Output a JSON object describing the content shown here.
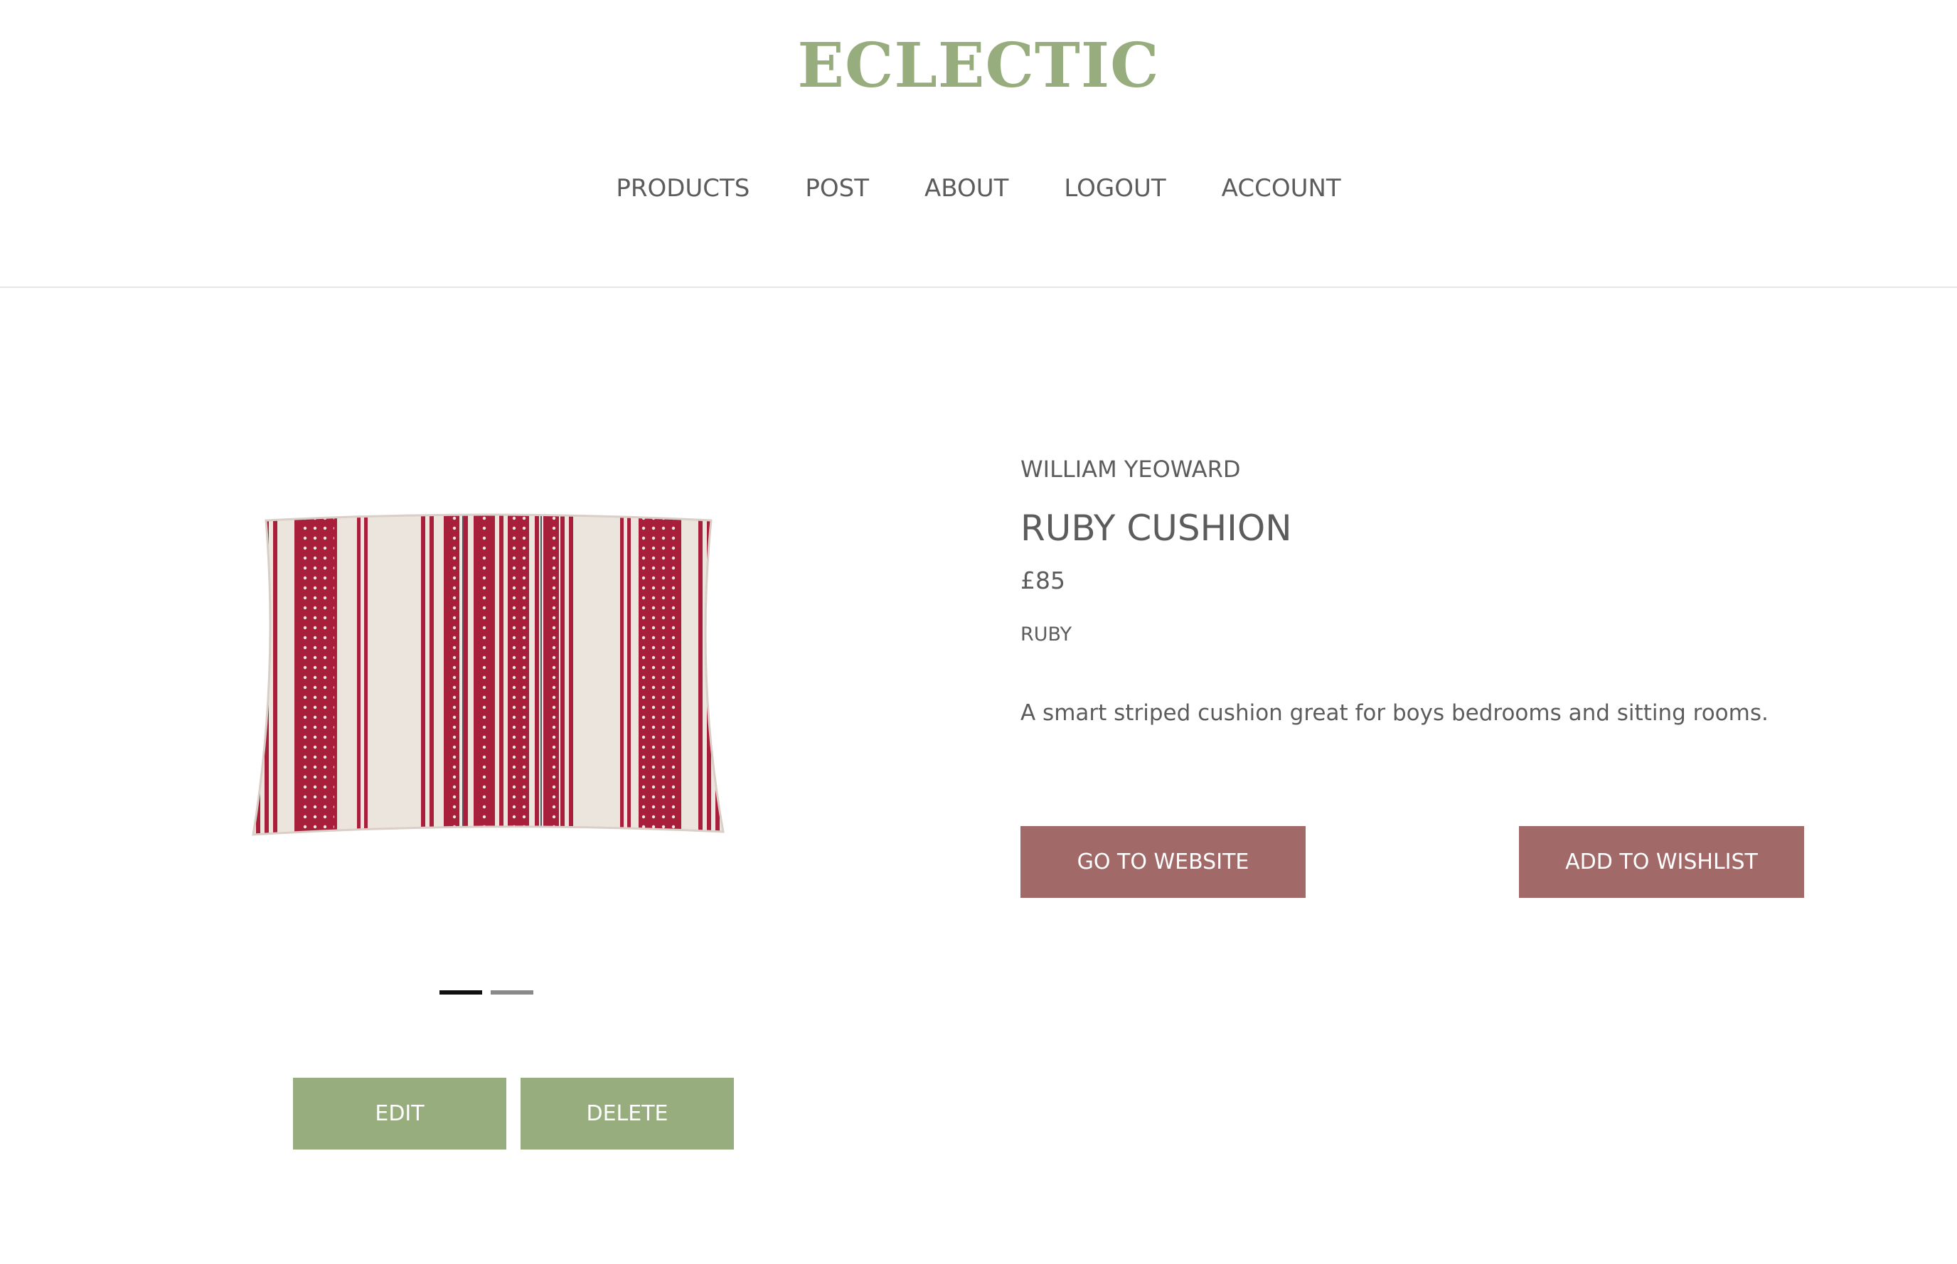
{
  "header": {
    "logo": "ECLECTIC",
    "nav": [
      "PRODUCTS",
      "POST",
      "ABOUT",
      "LOGOUT",
      "ACCOUNT"
    ]
  },
  "product": {
    "brand": "WILLIAM YEOWARD",
    "title": "RUBY CUSHION",
    "price": "£85",
    "color": "RUBY",
    "description": "A smart striped cushion great for boys bedrooms and sitting rooms."
  },
  "carousel": {
    "slide_count": 2,
    "active_index": 0
  },
  "actions": {
    "website_label": "GO TO WEBSITE",
    "wishlist_label": "ADD TO WISHLIST",
    "edit_label": "EDIT",
    "delete_label": "DELETE"
  },
  "colors": {
    "brand_green": "#98ad7e",
    "action_rose": "#a16a69",
    "text_gray": "#5c5c5c",
    "cushion_red": "#a71f3a",
    "dot_active": "#111111",
    "dot_inactive": "#8a8a8a"
  }
}
